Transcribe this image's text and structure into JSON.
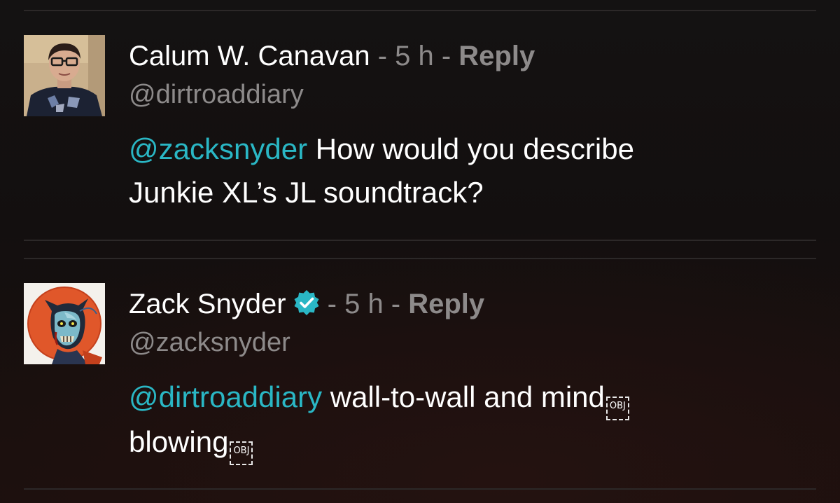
{
  "thread": {
    "tweets": [
      {
        "author_name": "Calum W. Canavan",
        "separator_1": " - ",
        "time": "5 h",
        "separator_2": " - ",
        "reply_label": "Reply",
        "handle": "@dirtroaddiary",
        "mention": "@zacksnyder",
        "text_line_1": " How would you describe",
        "text_line_2": "Junkie XL’s JL soundtrack?",
        "avatar_icon": "user-photo-avatar",
        "verified": false
      },
      {
        "author_name": "Zack Snyder",
        "separator_1": " - ",
        "time": "5 h",
        "separator_2": " - ",
        "reply_label": "Reply",
        "handle": "@zacksnyder",
        "mention": "@dirtroaddiary",
        "text_line_1": " wall-to-wall and mind",
        "text_line_2": "blowing",
        "object_placeholder": "OBJ",
        "avatar_icon": "zombie-art-avatar",
        "verified": true
      }
    ]
  },
  "colors": {
    "background": "#141212",
    "divider": "#2c2828",
    "author": "#ffffff",
    "meta": "#8d8a8a",
    "mention": "#2ab7c5",
    "verified_badge": "#2ab7c5"
  }
}
